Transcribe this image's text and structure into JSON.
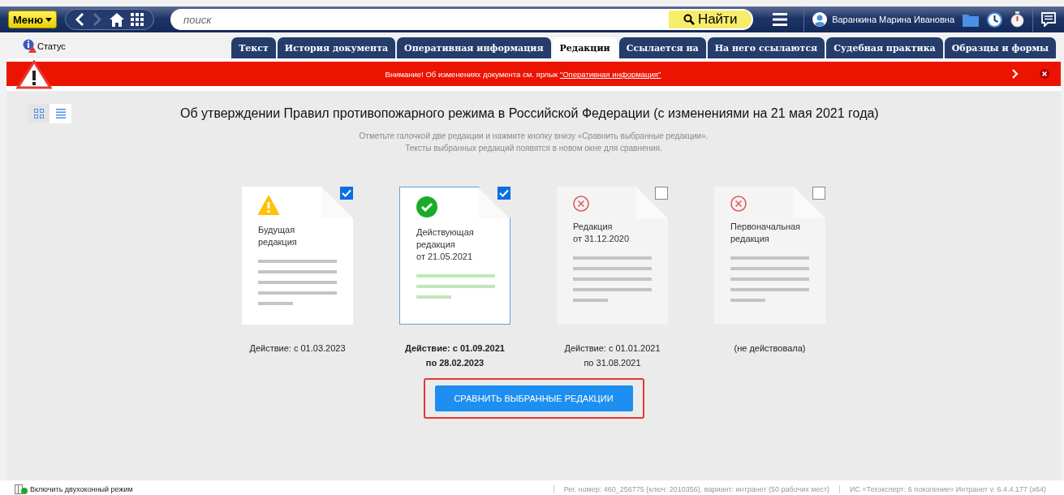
{
  "toolbar": {
    "menu": "Меню",
    "search": {
      "placeholder": "поиск"
    },
    "find": "Найти",
    "user": "Варанкина Марина Ивановна"
  },
  "status_link": "Статус",
  "tabs": [
    {
      "label": "Текст",
      "selected": false
    },
    {
      "label": "История документа",
      "selected": false
    },
    {
      "label": "Оперативная информация",
      "selected": false
    },
    {
      "label": "Редакции",
      "selected": true
    },
    {
      "label": "Ссылается на",
      "selected": false
    },
    {
      "label": "На него ссылаются",
      "selected": false
    },
    {
      "label": "Судебная практика",
      "selected": false
    },
    {
      "label": "Образцы и формы",
      "selected": false
    }
  ],
  "alert": {
    "text": "Внимание! Об изменениях документа см. ярлык ",
    "link": "\"Оперативная информация\""
  },
  "view_toggle": [
    {
      "kind": "grid",
      "selected": true
    },
    {
      "kind": "list",
      "selected": false
    }
  ],
  "title": "Об утверждении Правил противопожарного режима в Российской Федерации (с изменениями на 21 мая 2021 года)",
  "hint": [
    "Отметьте галочкой две редакции и нажмите кнопку внизу «Сравнить выбранные редакции».",
    "Тексты выбранных редакций появятся в новом окне для сравнения."
  ],
  "editions": [
    {
      "kind": "future",
      "checked": true,
      "title": [
        "Будущая",
        "редакция"
      ],
      "caption": [
        "Действие: с 01.03.2023"
      ]
    },
    {
      "kind": "current",
      "checked": true,
      "title": [
        "Действующая",
        "редакция",
        "от 21.05.2021"
      ],
      "caption": [
        "Действие: с 01.09.2021",
        "по 28.02.2023"
      ]
    },
    {
      "kind": "void",
      "checked": false,
      "title": [
        "Редакция",
        "от 31.12.2020"
      ],
      "caption": [
        "Действие: с 01.01.2021",
        "по 31.08.2021"
      ]
    },
    {
      "kind": "void",
      "checked": false,
      "title": [
        "Первоначальная",
        "редакция"
      ],
      "caption": [
        "(не действовала)"
      ]
    }
  ],
  "compare_button": "СРАВНИТЬ ВЫБРАННЫЕ РЕДАКЦИИ",
  "status_bar": {
    "dual_mode": "Включить двухоконный режим",
    "registration": "Рег. номер: 460_256775 (ключ: 2010356), вариант: интранет (50 рабочих мест)",
    "product": "ИС «Техэксперт: 6 поколение» Интранет v. 6.4.4.177 (x64)"
  }
}
